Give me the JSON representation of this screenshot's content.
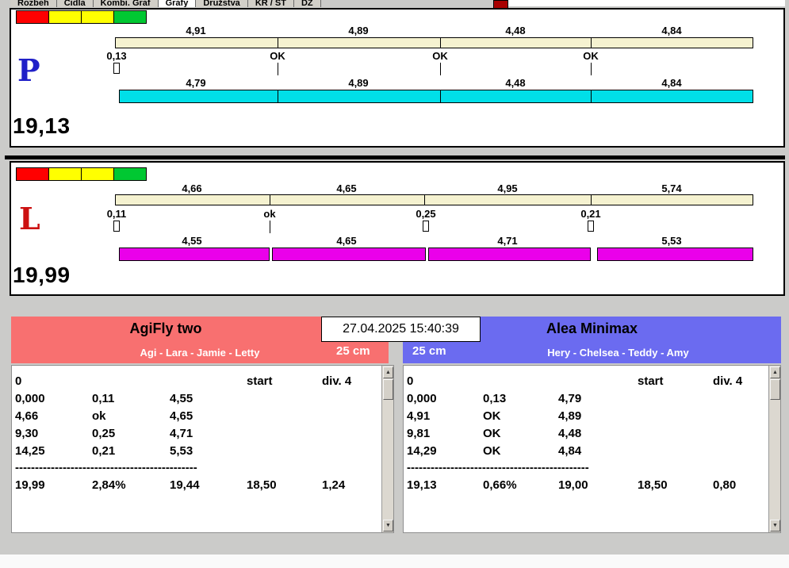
{
  "tab_bar": {
    "tabs": [
      {
        "label": "Rozbeh",
        "active": false
      },
      {
        "label": "Cidla",
        "active": false
      },
      {
        "label": "Kombi. Graf",
        "active": false
      },
      {
        "label": "Grafy",
        "active": true
      },
      {
        "label": "Družstva",
        "active": false
      },
      {
        "label": "KR / ST",
        "active": false
      },
      {
        "label": "DZ",
        "active": false
      }
    ]
  },
  "colors": {
    "window_bg": "#cbcbc9",
    "lane_p_bar": "#00dfe8",
    "lane_l_bar": "#ea00ea",
    "scale_bar": "#f5f2d0",
    "lane_p_letter": "#2020c8",
    "lane_l_letter": "#cc1111",
    "team_left_header": "#f87070",
    "team_right_header": "#6b6bf0",
    "traffic_red": "#ff0000",
    "traffic_yellow": "#ffff00",
    "traffic_green": "#00c832"
  },
  "lane_p": {
    "letter": "P",
    "total": "19,13",
    "scale_values": [
      "4,91",
      "4,89",
      "4,48",
      "4,84"
    ],
    "markers": [
      "0,13",
      "OK",
      "OK",
      "OK"
    ],
    "run_values": [
      "4,79",
      "4,89",
      "4,48",
      "4,84"
    ]
  },
  "lane_l": {
    "letter": "L",
    "total": "19,99",
    "scale_values": [
      "4,66",
      "4,65",
      "4,95",
      "5,74"
    ],
    "markers": [
      "0,11",
      "ok",
      "0,25",
      "0,21"
    ],
    "run_values": [
      "4,55",
      "4,65",
      "4,71",
      "5,53"
    ]
  },
  "info": {
    "timestamp": "27.04.2025 15:40:39"
  },
  "glyphs": {
    "scroll_up": "▲",
    "scroll_down": "▼"
  },
  "team_left": {
    "name": "AgiFly two",
    "members": "Agi - Lara - Jamie - Letty",
    "category": "25 cm",
    "header": {
      "zero": "0",
      "start": "start",
      "div": "div. 4"
    },
    "rows": [
      [
        "0,000",
        "0,11",
        "4,55"
      ],
      [
        "4,66",
        "ok",
        "4,65"
      ],
      [
        "9,30",
        "0,25",
        "4,71"
      ],
      [
        "14,25",
        "0,21",
        "5,53"
      ]
    ],
    "separator": "----------------------------------------------",
    "totals": {
      "time": "19,99",
      "pct": "2,84%",
      "net": "19,44",
      "standard": "18,50",
      "diff": "1,24"
    }
  },
  "team_right": {
    "name": "Alea Minimax",
    "members": "Hery - Chelsea - Teddy - Amy",
    "category": "25 cm",
    "header": {
      "zero": "0",
      "start": "start",
      "div": "div. 4"
    },
    "rows": [
      [
        "0,000",
        "0,13",
        "4,79"
      ],
      [
        "4,91",
        "OK",
        "4,89"
      ],
      [
        "9,81",
        "OK",
        "4,48"
      ],
      [
        "14,29",
        "OK",
        "4,84"
      ]
    ],
    "separator": "----------------------------------------------",
    "totals": {
      "time": "19,13",
      "pct": "0,66%",
      "net": "19,00",
      "standard": "18,50",
      "diff": "0,80"
    }
  }
}
